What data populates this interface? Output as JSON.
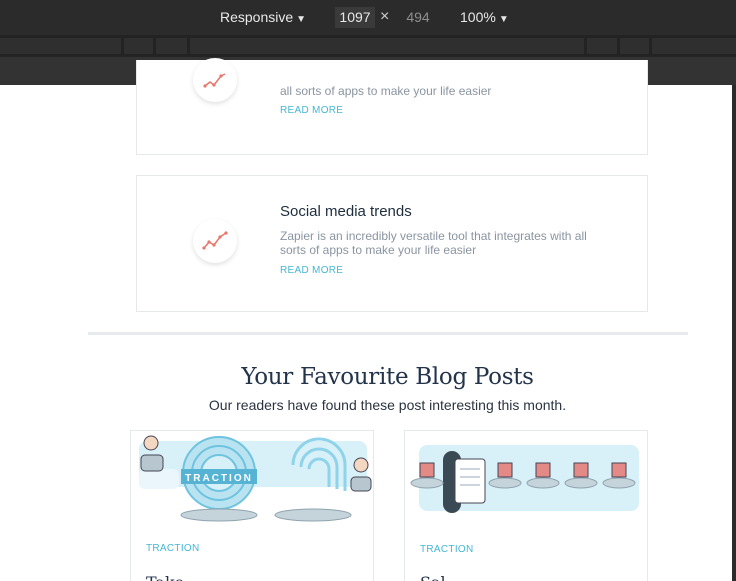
{
  "devtools": {
    "device_mode": "Responsive",
    "width": "1097",
    "height": "494",
    "zoom": "100%",
    "separator": "×",
    "dropdown_glyph": "▼"
  },
  "features": [
    {
      "title": "",
      "description": "all sorts of apps to make your life easier",
      "link": "READ MORE",
      "icon": "trend-chart-icon"
    },
    {
      "title": "Social media trends",
      "description": "Zapier is an incredibly versatile tool that integrates with all sorts of apps to make your life easier",
      "link": "READ MORE",
      "icon": "trend-chart-icon"
    }
  ],
  "blog": {
    "heading": "Your Favourite Blog Posts",
    "subheading": "Our readers have found these post interesting this month.",
    "posts": [
      {
        "tag": "TRACTION",
        "title": "Take…"
      },
      {
        "tag": "TRACTION",
        "title": "Sal…"
      }
    ]
  },
  "colors": {
    "accent": "#45b6d6",
    "heading": "#22334a",
    "icon": "#e9756a",
    "illustration_blue": "#8fd3ea",
    "illustration_pink": "#e38a86"
  }
}
